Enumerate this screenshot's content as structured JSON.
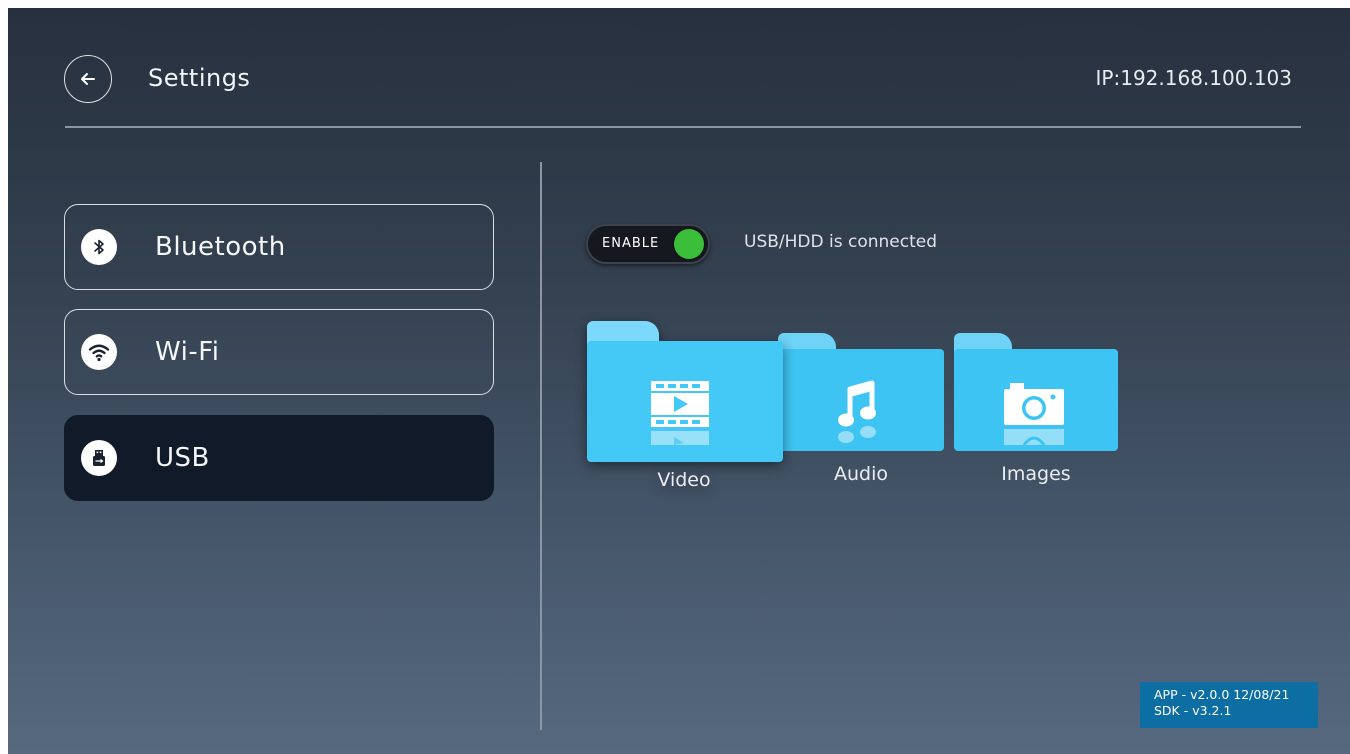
{
  "header": {
    "back_icon": "arrow-left-icon",
    "title": "Settings",
    "ip": "IP:192.168.100.103"
  },
  "nav": {
    "items": [
      {
        "label": "Bluetooth",
        "icon": "bluetooth-icon",
        "active": false
      },
      {
        "label": "Wi-Fi",
        "icon": "wifi-icon",
        "active": false
      },
      {
        "label": "USB",
        "icon": "usb-icon",
        "active": true
      }
    ]
  },
  "usb": {
    "toggle_label": "ENABLE",
    "toggle_on": true,
    "status": "USB/HDD is connected",
    "folders": [
      {
        "label": "Video",
        "icon": "video-icon",
        "selected": true
      },
      {
        "label": "Audio",
        "icon": "music-note-icon",
        "selected": false
      },
      {
        "label": "Images",
        "icon": "camera-icon",
        "selected": false
      }
    ]
  },
  "version": {
    "app": "APP - v2.0.0 12/08/21",
    "sdk": "SDK - v3.2.1"
  },
  "colors": {
    "folder": "#44c8f5",
    "folder_tab": "#7dd9fb",
    "active_nav": "#111a28",
    "toggle_on": "#3bbf3a",
    "version_bg": "#0d6ea3"
  }
}
